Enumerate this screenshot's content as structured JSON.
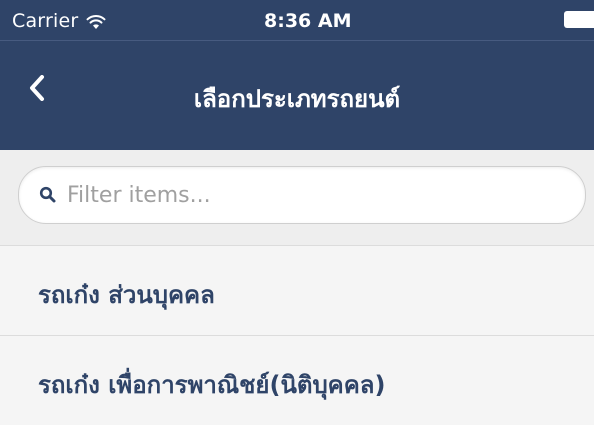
{
  "status_bar": {
    "carrier": "Carrier",
    "time": "8:36 AM",
    "wifi_icon": "wifi-icon",
    "battery_icon": "battery-icon"
  },
  "nav_bar": {
    "title": "เลือกประเภทรถยนต์",
    "back_icon": "chevron-left-icon"
  },
  "search": {
    "icon": "search-icon",
    "placeholder": "Filter items...",
    "value": ""
  },
  "list": {
    "items": [
      {
        "label": "รถเก๋ง ส่วนบุคคล"
      },
      {
        "label": "รถเก๋ง เพื่อการพาณิชย์(นิติบุคคล)"
      }
    ]
  },
  "colors": {
    "header_bg": "#2f4468",
    "list_text": "#2f4468",
    "content_bg": "#f2f2f2"
  }
}
